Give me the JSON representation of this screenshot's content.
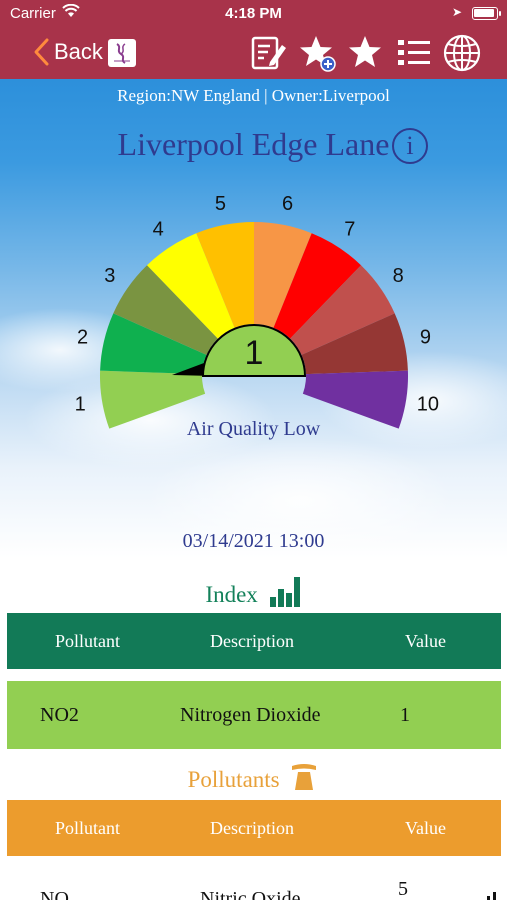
{
  "status_bar": {
    "carrier": "Carrier",
    "time": "4:18 PM"
  },
  "header": {
    "back_label": "Back",
    "icons": [
      "edit-icon",
      "favorite-add-icon",
      "favorite-icon",
      "list-icon",
      "globe-icon"
    ],
    "color": "#a8334a"
  },
  "site": {
    "region_line": "Region:NW England | Owner:Liverpool",
    "title": "Liverpool Edge Lane",
    "info_glyph": "i"
  },
  "gauge": {
    "labels": [
      "1",
      "2",
      "3",
      "4",
      "5",
      "6",
      "7",
      "8",
      "9",
      "10"
    ],
    "colors": [
      "#92cf52",
      "#0fb04f",
      "#7a9441",
      "#ffff00",
      "#ffc000",
      "#f79646",
      "#ff0000",
      "#c0504d",
      "#953734",
      "#7030a0"
    ],
    "current_value": "1",
    "status_text": "Air Quality Low"
  },
  "reading": {
    "datetime": "03/14/2021 13:00"
  },
  "index_section": {
    "title": "Index",
    "columns": [
      "Pollutant",
      "Description",
      "Value"
    ],
    "rows": [
      {
        "pollutant": "NO2",
        "description": "Nitrogen Dioxide",
        "value": "1"
      }
    ],
    "header_color": "#127a57",
    "row_color": "#92cf52"
  },
  "pollutants_section": {
    "title": "Pollutants",
    "columns": [
      "Pollutant",
      "Description",
      "Value"
    ],
    "rows": [
      {
        "pollutant": "NO",
        "description": "Nitric Oxide",
        "value": "5"
      }
    ],
    "header_color": "#ec9c2d"
  }
}
